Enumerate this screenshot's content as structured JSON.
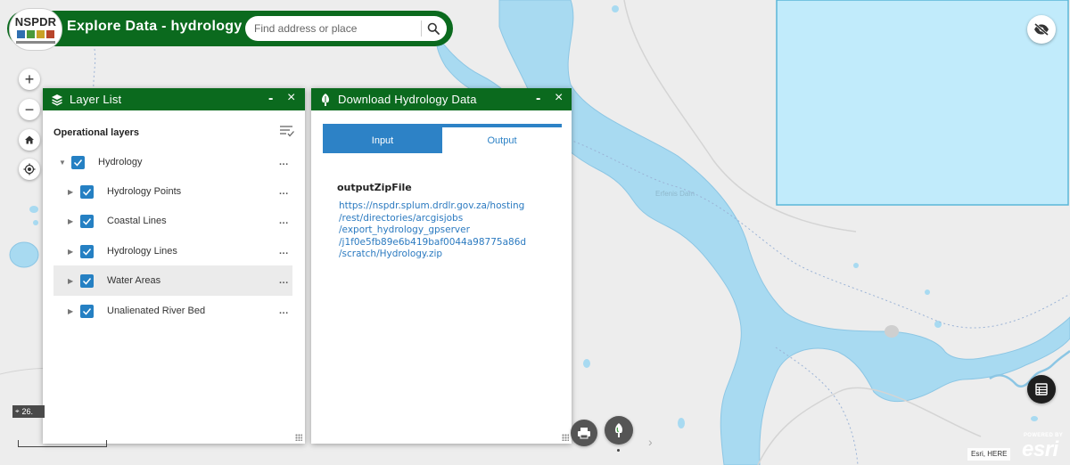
{
  "header": {
    "logo_text": "NSPDR",
    "title": "Explore Data - hydrology",
    "search_placeholder": "Find address or place",
    "search_icon": "search-icon"
  },
  "map_tools": {
    "zoom_in_label": "+",
    "zoom_out_label": "−",
    "home_icon": "home-icon",
    "locate_icon": "locate-icon",
    "visibility_icon": "eye-off-icon",
    "attribute_table_icon": "table-icon"
  },
  "layer_list": {
    "title": "Layer List",
    "minimize_label": "-",
    "close_label": "×",
    "section_label": "Operational layers",
    "layers": [
      {
        "label": "Hydrology",
        "checked": true
      },
      {
        "label": "Hydrology Points",
        "checked": true
      },
      {
        "label": "Coastal Lines",
        "checked": true
      },
      {
        "label": "Hydrology Lines",
        "checked": true
      },
      {
        "label": "Water Areas",
        "checked": true
      },
      {
        "label": "Unalienated River Bed",
        "checked": true
      }
    ],
    "more_label": "..."
  },
  "download_panel": {
    "title": "Download Hydrology Data",
    "minimize_label": "-",
    "close_label": "×",
    "tabs": [
      {
        "label": "Input",
        "active": true
      },
      {
        "label": "Output",
        "active": false
      }
    ],
    "output_label": "outputZipFile",
    "output_link": "https://nspdr.splum.drdlr.gov.za/hosting/rest/directories/arcgisjobs/export_hydrology_gpserver/j1f0e5fb89e6b419baf0044a98775a86d/scratch/Hydrology.zip",
    "output_link_lines": [
      "https://nspdr.splum.drdlr.gov.za/hosting",
      "/rest/directories/arcgisjobs",
      "/export_hydrology_gpserver",
      "/j1f0e5fb89e6b419baf0044a98775a86d",
      "/scratch/Hydrology.zip"
    ]
  },
  "map": {
    "water_label": "Erfenis Dam",
    "coord_text": "26.",
    "attribution": "Esri, HERE",
    "esri_powered": "POWERED BY",
    "esri_word": "esri"
  },
  "colors": {
    "header_green": "#0b6a1e",
    "accent_blue": "#2d82c6",
    "water": "#a8daf1",
    "land": "#ededed"
  }
}
